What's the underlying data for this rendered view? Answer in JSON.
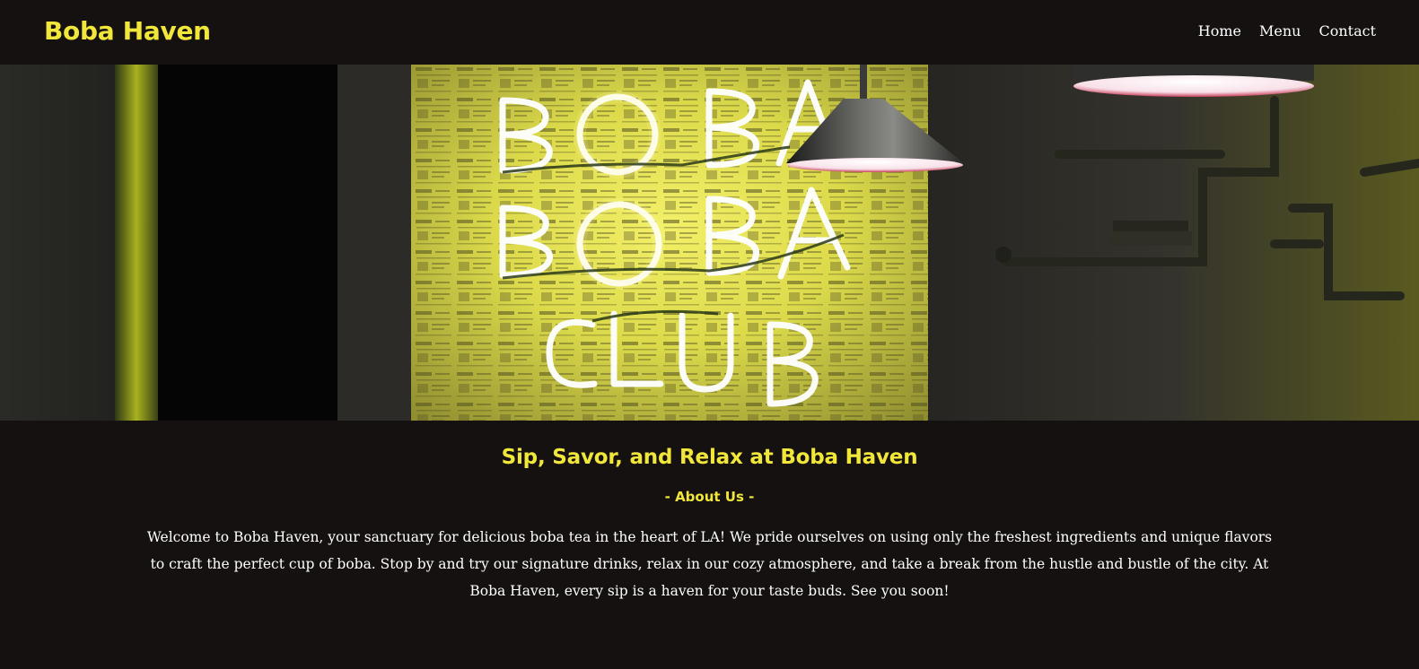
{
  "header": {
    "brand": "Boba Haven",
    "nav": [
      {
        "label": "Home"
      },
      {
        "label": "Menu"
      },
      {
        "label": "Contact"
      }
    ]
  },
  "hero": {
    "sign_lines": [
      "BOBA",
      "BOBA",
      "CLUB"
    ]
  },
  "main": {
    "headline": "Sip, Savor, and Relax at Boba Haven",
    "section_label": "- About Us -",
    "about_text": "Welcome to Boba Haven, your sanctuary for delicious boba tea in the heart of LA! We pride ourselves on using only the freshest ingredients and unique flavors to craft the perfect cup of boba. Stop by and try our signature drinks, relax in our cozy atmosphere, and take a break from the hustle and bustle of the city. At Boba Haven, every sip is a haven for your taste buds. See you soon!"
  },
  "colors": {
    "background": "#151110",
    "accent": "#f1e73a",
    "text": "#ffffff"
  }
}
